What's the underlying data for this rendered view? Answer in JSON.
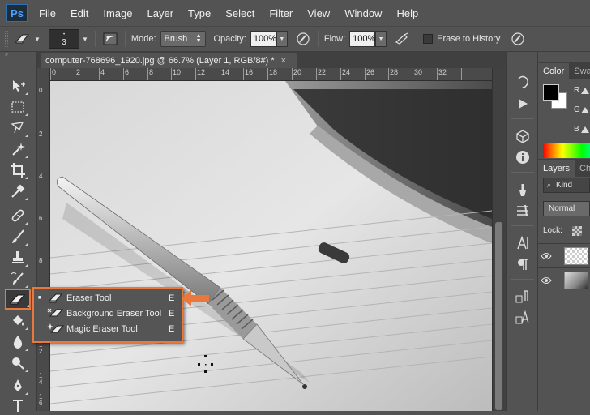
{
  "app": {
    "logo_text": "Ps"
  },
  "menu": [
    "File",
    "Edit",
    "Image",
    "Layer",
    "Type",
    "Select",
    "Filter",
    "View",
    "Window",
    "Help"
  ],
  "options": {
    "brush_size": "3",
    "mode_label": "Mode:",
    "mode_value": "Brush",
    "opacity_label": "Opacity:",
    "opacity_value": "100%",
    "flow_label": "Flow:",
    "flow_value": "100%",
    "erase_history_label": "Erase to History",
    "erase_history_checked": false
  },
  "document": {
    "tab_title": "computer-768696_1920.jpg @ 66.7% (Layer 1, RGB/8#) *",
    "close_glyph": "×",
    "ruler_top_labels": [
      "2",
      "0",
      "2",
      "4",
      "6",
      "8",
      "10",
      "12",
      "14",
      "16",
      "18",
      "20",
      "22",
      "24",
      "26",
      "28",
      "30",
      "32"
    ],
    "ruler_left_labels": [
      "0",
      "2",
      "4",
      "6",
      "8",
      "1 0",
      "1 2",
      "1 4",
      "1 6"
    ]
  },
  "flyout": {
    "items": [
      {
        "label": "Eraser Tool",
        "shortcut": "E",
        "selected": true,
        "icon": "eraser-icon"
      },
      {
        "label": "Background Eraser Tool",
        "shortcut": "E",
        "selected": false,
        "icon": "background-eraser-icon"
      },
      {
        "label": "Magic Eraser Tool",
        "shortcut": "E",
        "selected": false,
        "icon": "magic-eraser-icon"
      }
    ],
    "bullet": "■"
  },
  "panels": {
    "color_tabs": [
      "Color",
      "Swa"
    ],
    "rgb_labels": [
      "R",
      "G",
      "B"
    ],
    "layers_tabs": [
      "Layers",
      "Ch"
    ],
    "kind_label": "Kind",
    "blend_mode": "Normal",
    "lock_label": "Lock:"
  },
  "colors": {
    "accent": "#e8783b",
    "ui_bg": "#535353",
    "foreground": "#000000",
    "background": "#ffffff"
  }
}
